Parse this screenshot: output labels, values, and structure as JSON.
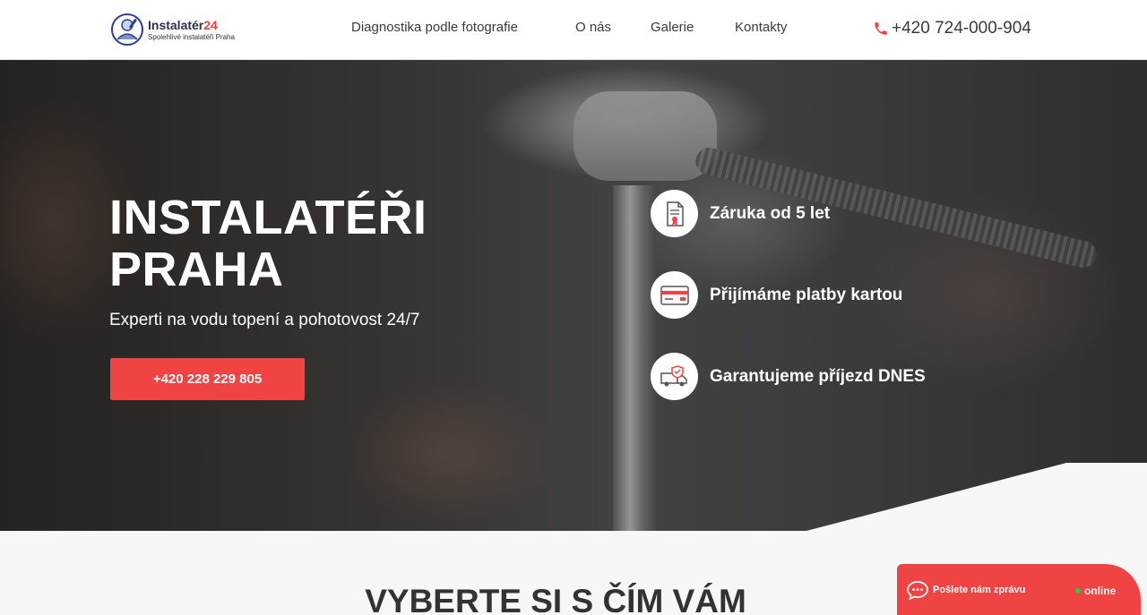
{
  "brand": {
    "name_main": "Instalatér",
    "name_accent": "24",
    "tagline": "Spolehlivé instalatéři Praha"
  },
  "nav": {
    "items": [
      {
        "label": "Diagnostika podle fotografie"
      },
      {
        "label": "O nás"
      },
      {
        "label": "Galerie"
      },
      {
        "label": "Kontakty"
      }
    ]
  },
  "header_phone": "+420 724-000-904",
  "hero": {
    "title": "INSTALATÉŘI PRAHA",
    "subtitle": "Experti na vodu topení a pohotovost 24/7",
    "cta_label": "+420 228 229 805",
    "features": [
      {
        "label": "Záruka od 5 let",
        "icon": "certificate-icon"
      },
      {
        "label": "Přijímáme platby kartou",
        "icon": "credit-card-icon"
      },
      {
        "label": "Garantujeme příjezd DNES",
        "icon": "delivery-truck-icon"
      }
    ]
  },
  "section": {
    "title": "VYBERTE SI S ČÍM VÁM"
  },
  "chat": {
    "label": "Pošlete nám zprávu",
    "status": "online"
  },
  "colors": {
    "accent": "#f04344",
    "text_dark": "#333333",
    "status_green": "#2ecc40"
  }
}
